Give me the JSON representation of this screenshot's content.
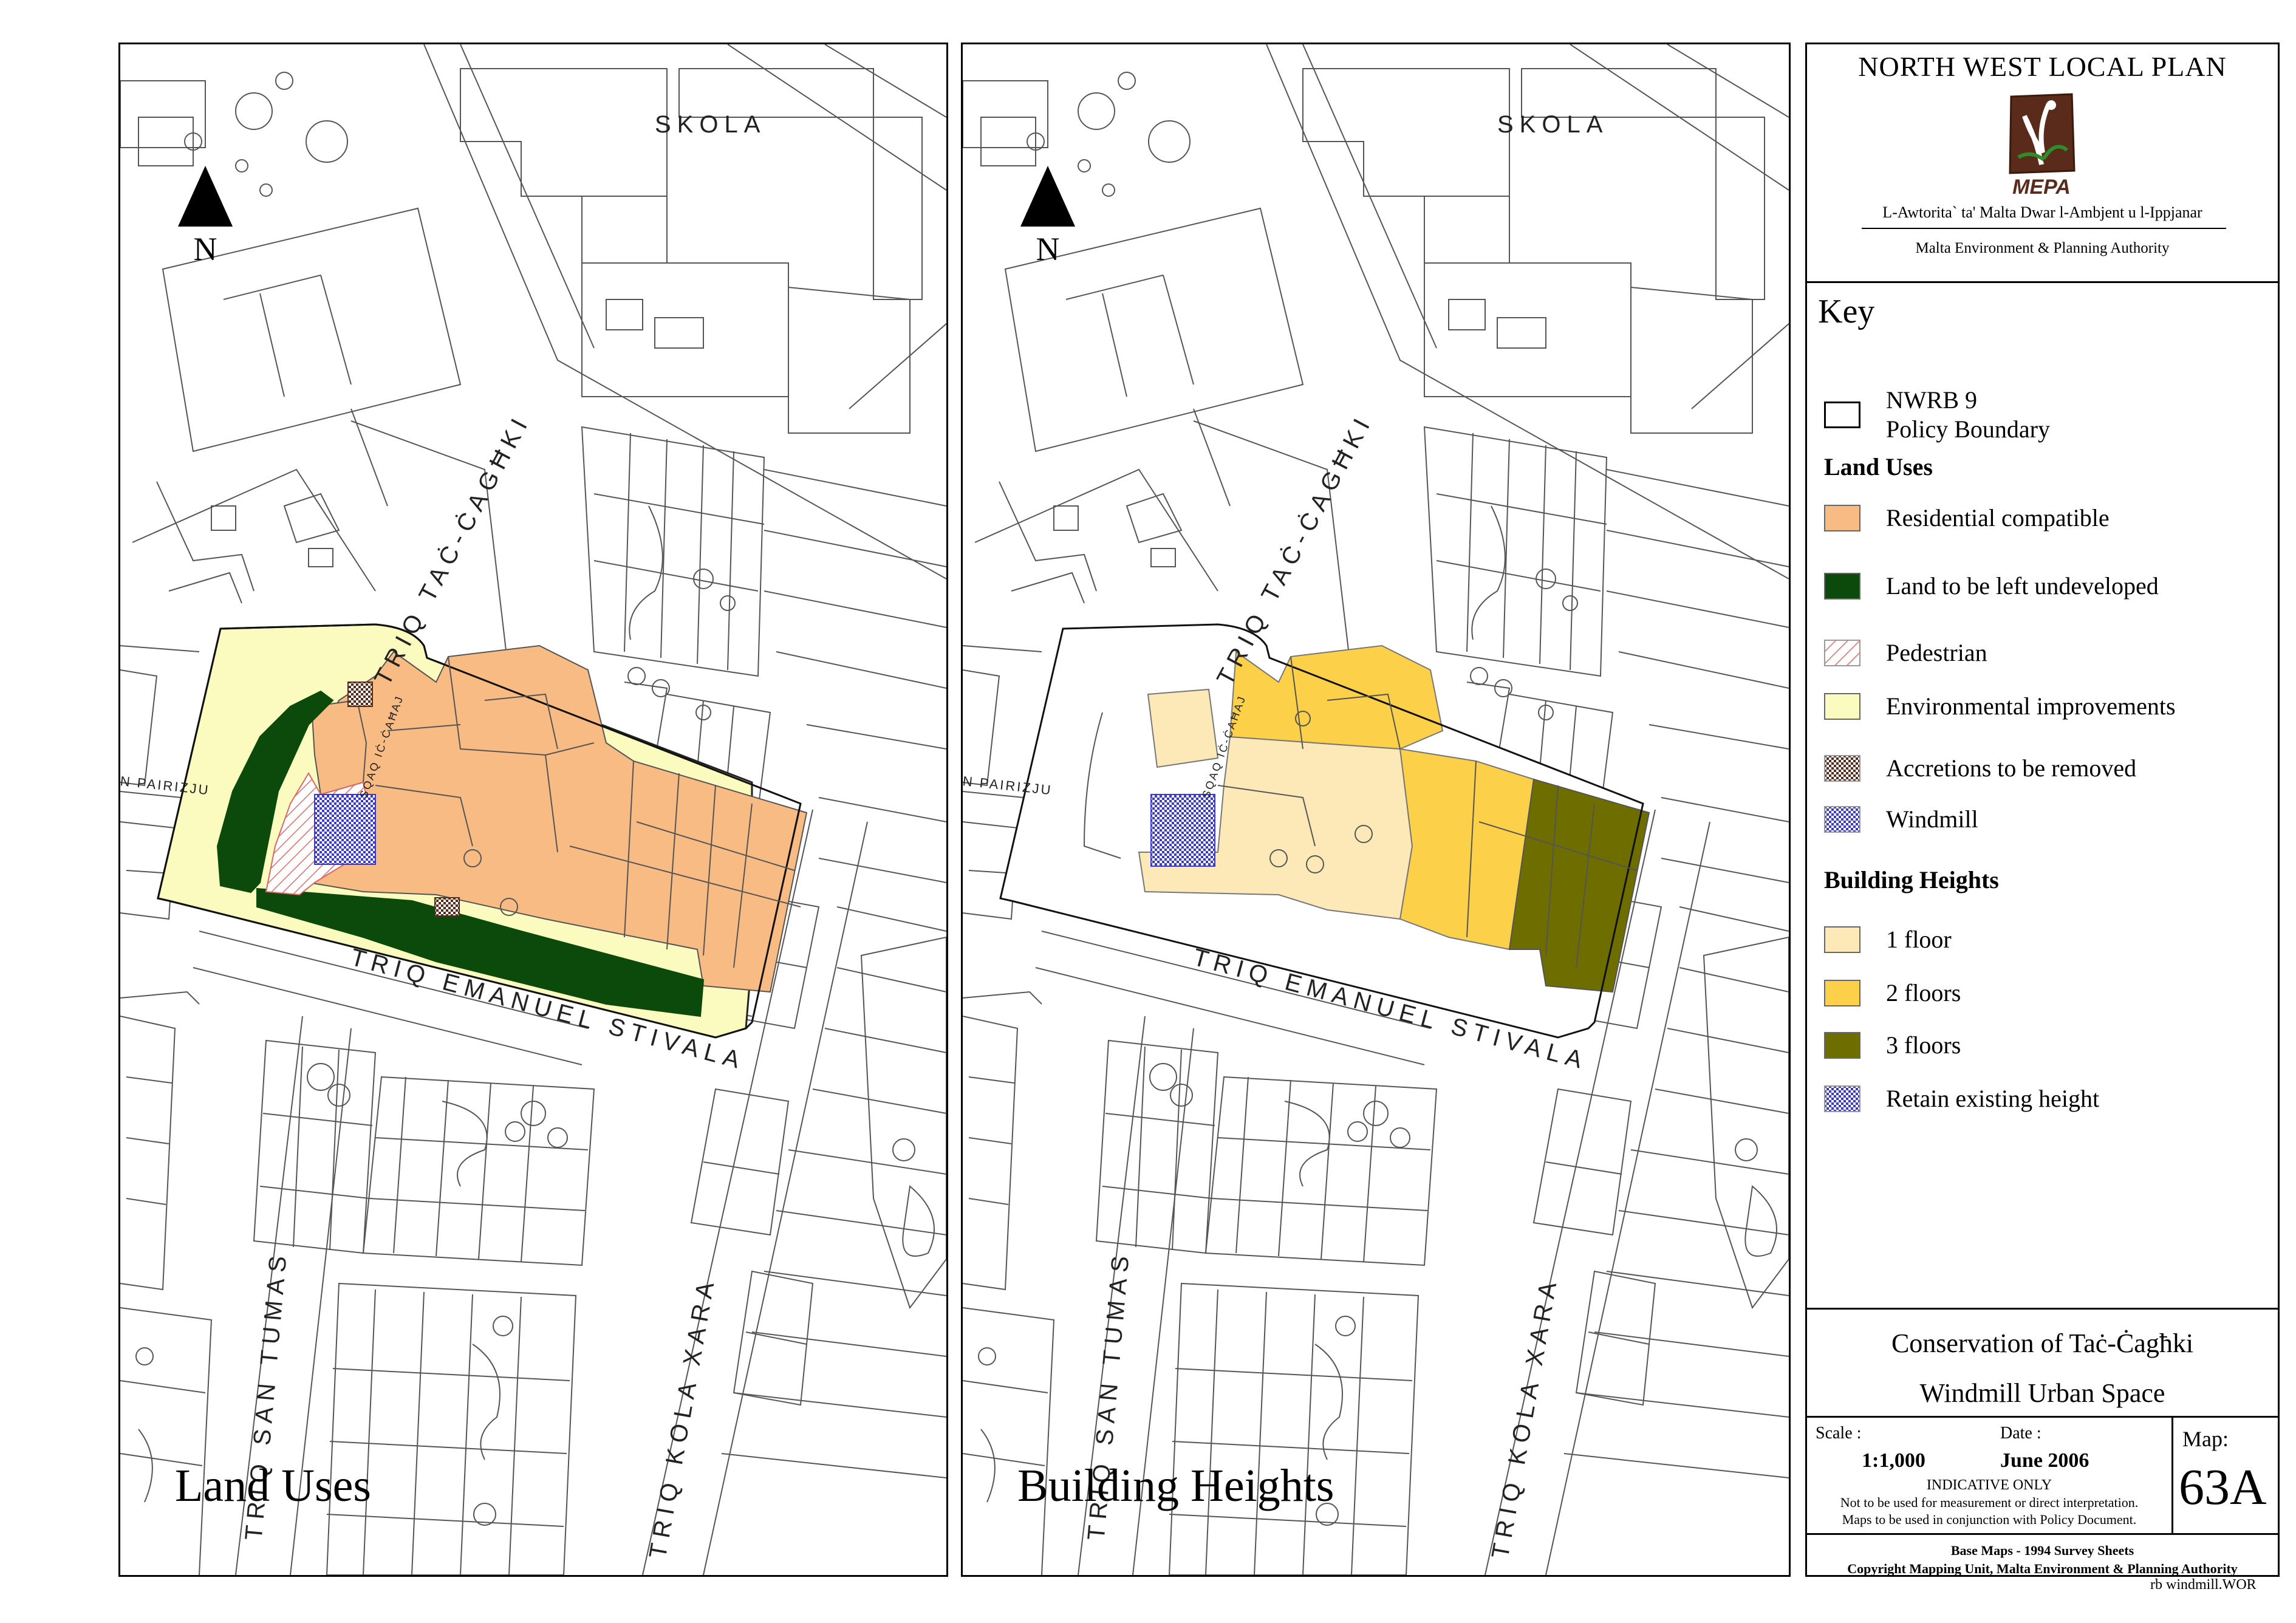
{
  "maps": {
    "land_uses": {
      "title": "Land Uses",
      "north": "N",
      "streets": {
        "skola": "SKOLA",
        "tac_caghki": "TRIQ TAĊ-ĊAGĦKI",
        "emanuel_stivala": "TRIQ EMANUEL STIVALA",
        "pairizju": "N PAIRIZJU",
        "san_tumas": "TRIQ SAN TUMAS",
        "kola_xara": "TRIQ KOLA XARA",
        "sqaq": "SQAQ IĊ-ĊAĦAJ"
      }
    },
    "building_heights": {
      "title": "Building Heights",
      "north": "N",
      "streets": {
        "skola": "SKOLA",
        "tac_caghki": "TRIQ TAĊ-ĊAGĦKI",
        "emanuel_stivala": "TRIQ EMANUEL STIVALA",
        "pairizju": "N PAIRIZJU",
        "san_tumas": "TRIQ SAN TUMAS",
        "kola_xara": "TRIQ KOLA XARA",
        "sqaq": "SQAQ IĊ-ĊAĦAJ"
      }
    }
  },
  "panel": {
    "plan_title": "NORTH WEST LOCAL PLAN",
    "logo_name": "MEPA",
    "authority_mt": "L-Awtorita` ta' Malta Dwar l-Ambjent u l-Ippjanar",
    "authority_en": "Malta Environment & Planning Authority",
    "key_title": "Key",
    "boundary_line1": "NWRB 9",
    "boundary_line2": "Policy Boundary",
    "land_uses_heading": "Land Uses",
    "land_uses": [
      {
        "label": "Residential compatible",
        "color": "#f8bb84"
      },
      {
        "label": "Land to be left undeveloped",
        "color": "#0b4a0b"
      },
      {
        "label": "Pedestrian",
        "color": "#e86a6a"
      },
      {
        "label": "Environmental improvements",
        "color": "#fbfbbf"
      },
      {
        "label": "Accretions to be removed",
        "color": "#5a2a1a"
      },
      {
        "label": "Windmill",
        "color": "#3a3ad8"
      }
    ],
    "heights_heading": "Building Heights",
    "heights": [
      {
        "label": "1 floor",
        "color": "#fde9b8"
      },
      {
        "label": "2 floors",
        "color": "#fcd049"
      },
      {
        "label": "3 floors",
        "color": "#6d6d00"
      },
      {
        "label": "Retain existing height",
        "color": "#3a3ad8"
      }
    ],
    "conservation_title": "Conservation of Taċ-Ċagħki",
    "conservation_sub": "Windmill Urban Space",
    "scale_label": "Scale :",
    "scale_value": "1:1,000",
    "date_label": "Date :",
    "date_value": "June 2006",
    "indicative": "INDICATIVE ONLY",
    "disclaimer1": "Not to be used for measurement or direct interpretation.",
    "disclaimer2": "Maps to be used in conjunction with Policy Document.",
    "map_label": "Map:",
    "map_number": "63A",
    "base_maps": "Base Maps - 1994 Survey Sheets",
    "copyright": "Copyright Mapping Unit, Malta Environment & Planning Authority",
    "file_ref": "rb windmill.WOR"
  }
}
